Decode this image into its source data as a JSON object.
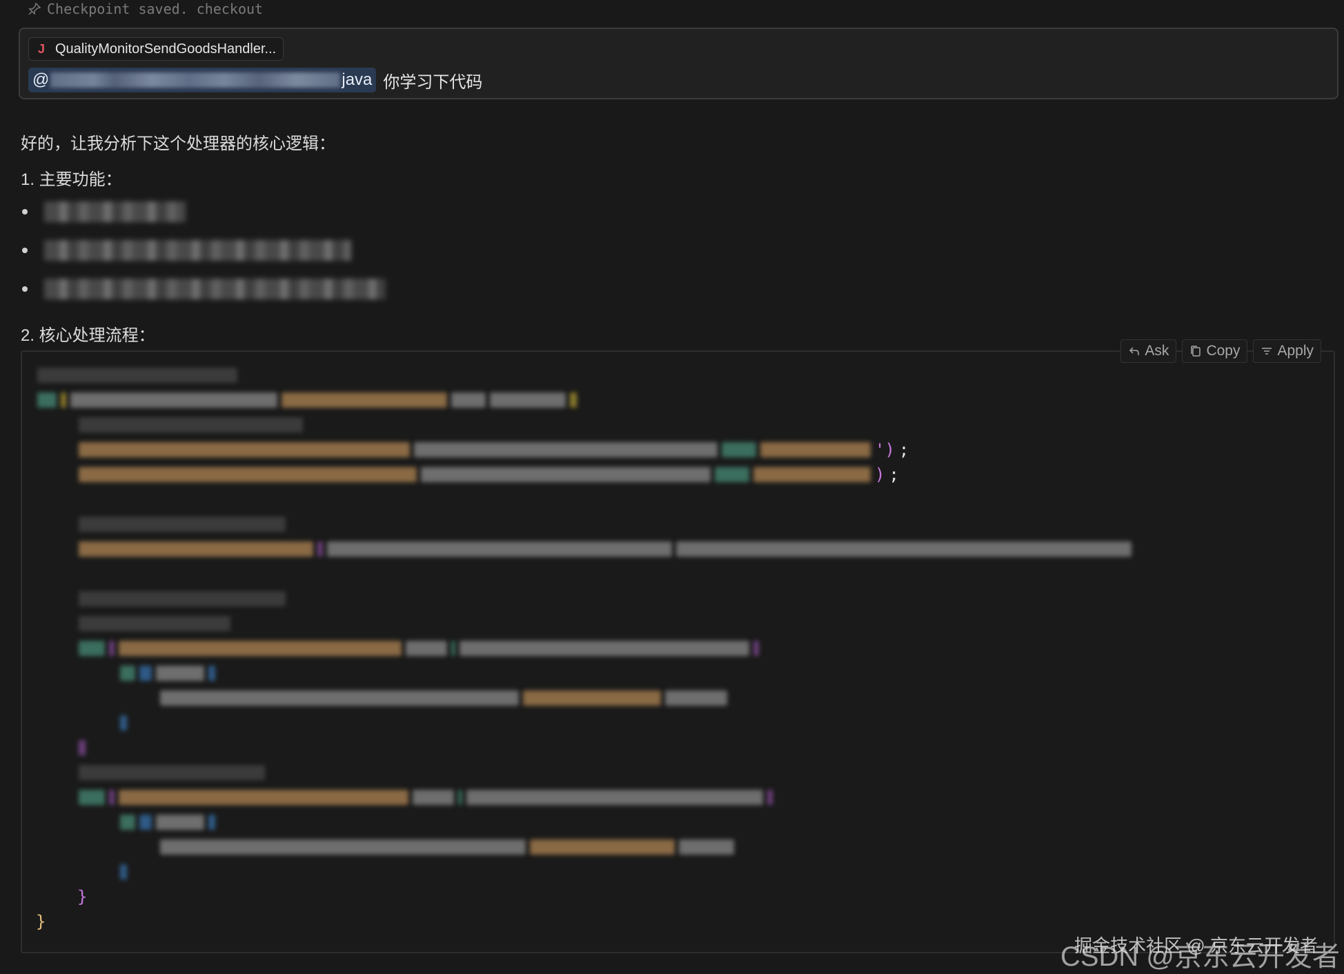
{
  "checkpoint": {
    "icon": "pin-icon",
    "text": "Checkpoint saved. checkout"
  },
  "input": {
    "file_chip": {
      "icon": "java-file-icon",
      "icon_glyph": "J",
      "label": "QualityMonitorSendGoodsHandler..."
    },
    "mention_prefix": "@",
    "mention_suffix": "java",
    "query_text": "你学习下代码"
  },
  "response": {
    "intro": "好的，让我分析下这个处理器的核心逻辑：",
    "section1": "1. 主要功能：",
    "bullets": [
      "[redacted]",
      "[redacted]",
      "[redacted]"
    ],
    "section2": "2. 核心处理流程："
  },
  "code_block": {
    "actions": [
      {
        "label": "Ask",
        "icon": "reply-arrow-icon"
      },
      {
        "label": "Copy",
        "icon": "copy-icon"
      },
      {
        "label": "Apply",
        "icon": "apply-filter-icon"
      }
    ],
    "visible_glyphs": {
      "line3_end": "');",
      "line4_end": ");",
      "inner_close": "}",
      "outer_close": "}"
    }
  },
  "watermark": {
    "line1": "掘金技术社区 @ 京东云开发者",
    "line2": "CSDN @京东云开发者"
  }
}
